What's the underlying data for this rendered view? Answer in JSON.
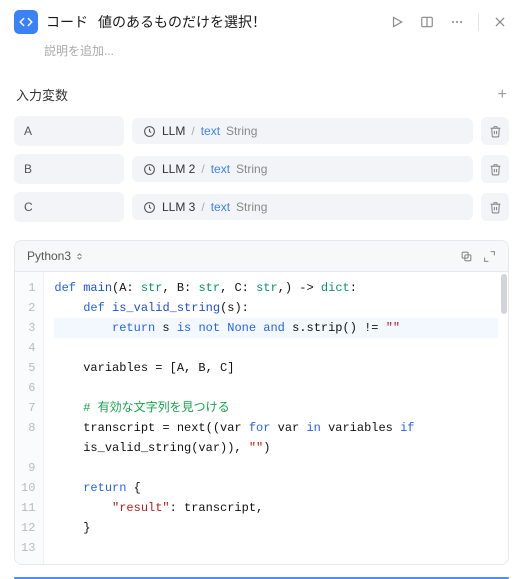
{
  "header": {
    "type": "コード",
    "title": "値のあるものだけを選択！",
    "desc_placeholder": "説明を追加..."
  },
  "inputs": {
    "section_label": "入力変数",
    "rows": [
      {
        "name": "A",
        "source": "LLM",
        "field": "text",
        "type": "String"
      },
      {
        "name": "B",
        "source": "LLM 2",
        "field": "text",
        "type": "String"
      },
      {
        "name": "C",
        "source": "LLM 3",
        "field": "text",
        "type": "String"
      }
    ]
  },
  "code": {
    "language": "Python3",
    "lines": [
      [
        [
          "kw",
          "def"
        ],
        [
          "py",
          " "
        ],
        [
          "fn",
          "main"
        ],
        [
          "py",
          "(A: "
        ],
        [
          "ty",
          "str"
        ],
        [
          "py",
          ", B: "
        ],
        [
          "ty",
          "str"
        ],
        [
          "py",
          ", C: "
        ],
        [
          "ty",
          "str"
        ],
        [
          "py",
          ",) -> "
        ],
        [
          "ty",
          "dict"
        ],
        [
          "py",
          ":"
        ]
      ],
      [
        [
          "py",
          "    "
        ],
        [
          "kw",
          "def"
        ],
        [
          "py",
          " "
        ],
        [
          "fn",
          "is_valid_string"
        ],
        [
          "py",
          "(s):"
        ]
      ],
      [
        [
          "py",
          "        "
        ],
        [
          "kw",
          "return"
        ],
        [
          "py",
          " s "
        ],
        [
          "kw",
          "is not"
        ],
        [
          "py",
          " "
        ],
        [
          "kw",
          "None"
        ],
        [
          "py",
          " "
        ],
        [
          "kw",
          "and"
        ],
        [
          "py",
          " s.strip() != "
        ],
        [
          "str",
          "\"\""
        ]
      ],
      [],
      [
        [
          "py",
          "    variables = [A, B, C]"
        ]
      ],
      [],
      [
        [
          "py",
          "    "
        ],
        [
          "cm",
          "# 有効な文字列を見つける"
        ]
      ],
      [
        [
          "py",
          "    transcript = next((var "
        ],
        [
          "kw",
          "for"
        ],
        [
          "py",
          " var "
        ],
        [
          "kw",
          "in"
        ],
        [
          "py",
          " variables "
        ],
        [
          "kw",
          "if"
        ]
      ],
      [
        [
          "py",
          "    is_valid_string(var)), "
        ],
        [
          "str",
          "\"\""
        ],
        [
          "py",
          ")"
        ]
      ],
      [],
      [
        [
          "py",
          "    "
        ],
        [
          "kw",
          "return"
        ],
        [
          "py",
          " {"
        ]
      ],
      [
        [
          "py",
          "        "
        ],
        [
          "str",
          "\"result\""
        ],
        [
          "py",
          ": transcript,"
        ]
      ],
      [
        [
          "py",
          "    }"
        ]
      ],
      []
    ],
    "gutter": [
      "1",
      "2",
      "3",
      "4",
      "5",
      "6",
      "7",
      "8",
      "",
      "9",
      "10",
      "11",
      "12",
      "13"
    ]
  }
}
